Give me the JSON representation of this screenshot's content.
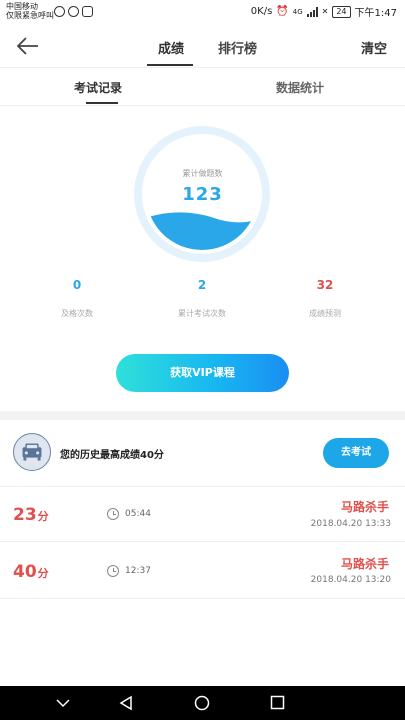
{
  "status_bar": {
    "carrier_line1": "中国移动",
    "carrier_line2": "仅限紧急呼叫",
    "speed": "0K/s",
    "network": "4G",
    "battery": "24",
    "time": "下午1:47"
  },
  "header": {
    "tabs": [
      {
        "label": "成绩"
      },
      {
        "label": "排行榜"
      }
    ],
    "right_action": "清空"
  },
  "sub_tabs": [
    {
      "label": "考试记录"
    },
    {
      "label": "数据统计"
    }
  ],
  "gauge": {
    "label": "累计做题数",
    "value": "123",
    "fill_fraction": 0.3
  },
  "stats": [
    {
      "value": "0",
      "label": "及格次数"
    },
    {
      "value": "2",
      "label": "累计考试次数"
    },
    {
      "value": "32",
      "label": "成绩预测"
    }
  ],
  "vip_button": "获取VIP课程",
  "best": {
    "text": "您的历史最高成绩40分",
    "button": "去考试"
  },
  "records": [
    {
      "score": "23",
      "unit": "分",
      "duration": "05:44",
      "level": "马路杀手",
      "date": "2018.04.20  13:33"
    },
    {
      "score": "40",
      "unit": "分",
      "duration": "12:37",
      "level": "马路杀手",
      "date": "2018.04.20  13:20"
    }
  ],
  "colors": {
    "accent": "#2aa7e8",
    "score_red": "#e0504c",
    "vip_start": "#2fe0d9",
    "vip_end": "#1a8ef2"
  }
}
